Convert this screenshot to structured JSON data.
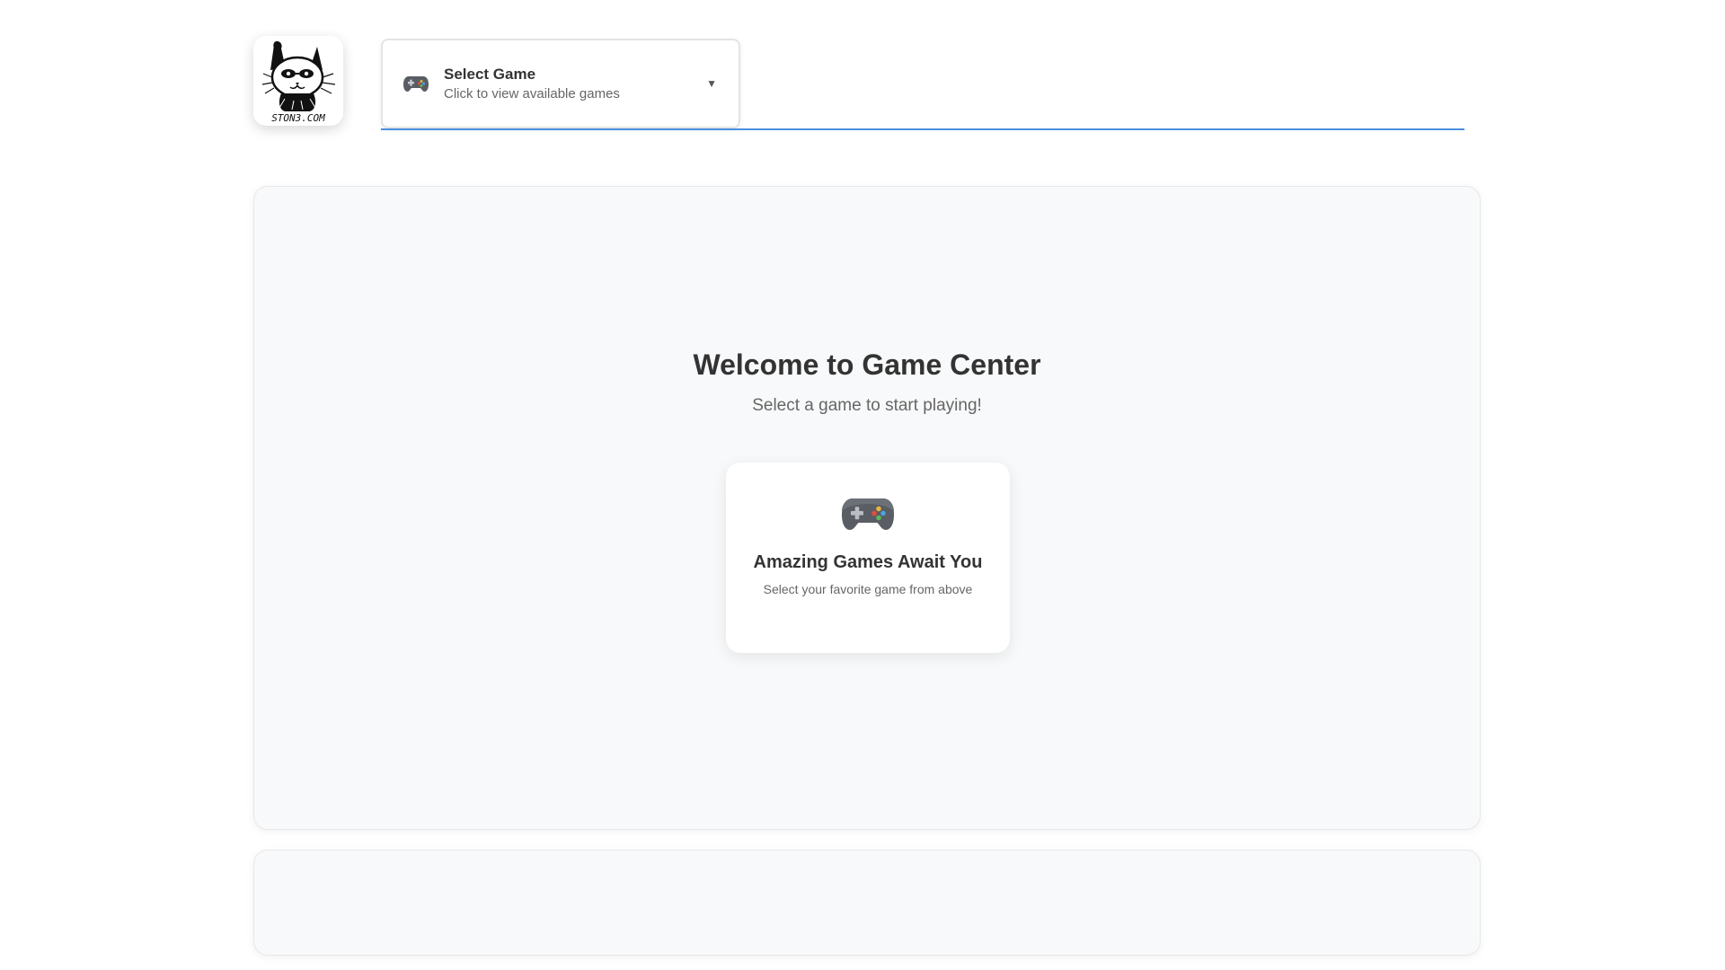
{
  "header": {
    "logo": {
      "icon": "cat-logo-icon",
      "text": "STON3.COM"
    },
    "game_selector": {
      "icon": "gamepad-icon",
      "title": "Select Game",
      "subtitle": "Click to view available games",
      "caret": "▼",
      "caret_icon": "caret-down-icon"
    },
    "accent_color": "#4a90e2"
  },
  "main": {
    "title": "Welcome to Game Center",
    "subtitle": "Select a game to start playing!",
    "card": {
      "icon": "gamepad-icon",
      "title": "Amazing Games Await You",
      "subtitle": "Select your favorite game from above"
    }
  }
}
